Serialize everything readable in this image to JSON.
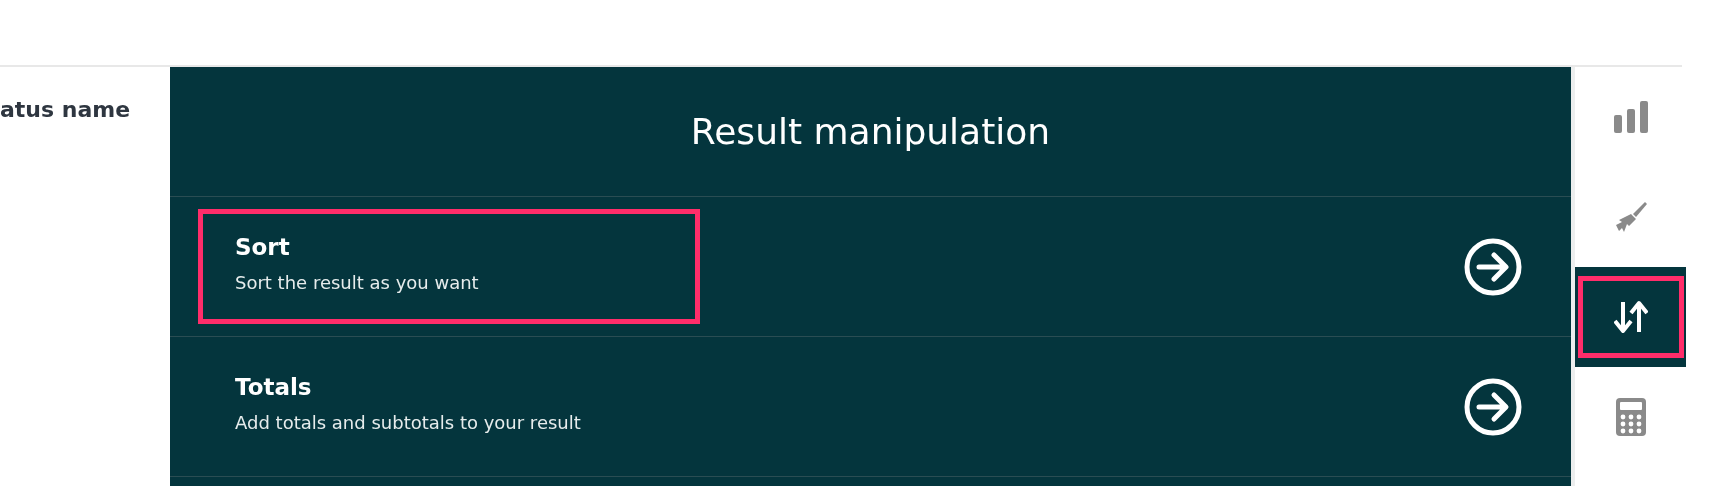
{
  "table": {
    "column_header": "atus name"
  },
  "panel": {
    "title": "Result manipulation",
    "items": [
      {
        "title": "Sort",
        "description": "Sort the result as you want",
        "highlighted": true
      },
      {
        "title": "Totals",
        "description": "Add totals and subtotals to your result",
        "highlighted": false
      }
    ]
  },
  "toolbar": [
    {
      "kind": "chart",
      "selected": false,
      "highlighted": false
    },
    {
      "kind": "brush",
      "selected": false,
      "highlighted": false
    },
    {
      "kind": "sort",
      "selected": true,
      "highlighted": true
    },
    {
      "kind": "calculator",
      "selected": false,
      "highlighted": false
    }
  ]
}
